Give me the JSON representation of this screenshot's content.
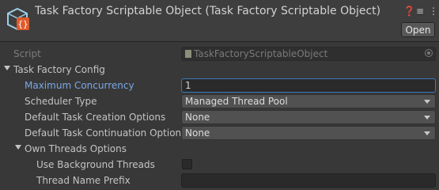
{
  "header": {
    "title": "Task Factory Scriptable Object (Task Factory Scriptable Object)",
    "open_label": "Open",
    "icons": [
      "asset-icon",
      "help-icon",
      "preset-icon",
      "menu-icon"
    ]
  },
  "fields": {
    "script": {
      "label": "Script",
      "value": "TaskFactoryScriptableObject"
    },
    "config_label": "Task Factory Config",
    "max_concurrency": {
      "label": "Maximum Concurrency",
      "value": "1"
    },
    "scheduler_type": {
      "label": "Scheduler Type",
      "value": "Managed Thread Pool"
    },
    "creation_options": {
      "label": "Default Task Creation Options",
      "value": "None"
    },
    "continuation_options": {
      "label": "Default Task Continuation Options",
      "value": "None"
    },
    "own_threads_label": "Own Threads Options",
    "use_background_threads": {
      "label": "Use Background Threads",
      "checked": false
    },
    "thread_name_prefix": {
      "label": "Thread Name Prefix",
      "value": ""
    }
  },
  "colors": {
    "background": "#383838",
    "header": "#3e3e3e",
    "focus": "#3a79bb",
    "active_label": "#7aa8e6"
  }
}
